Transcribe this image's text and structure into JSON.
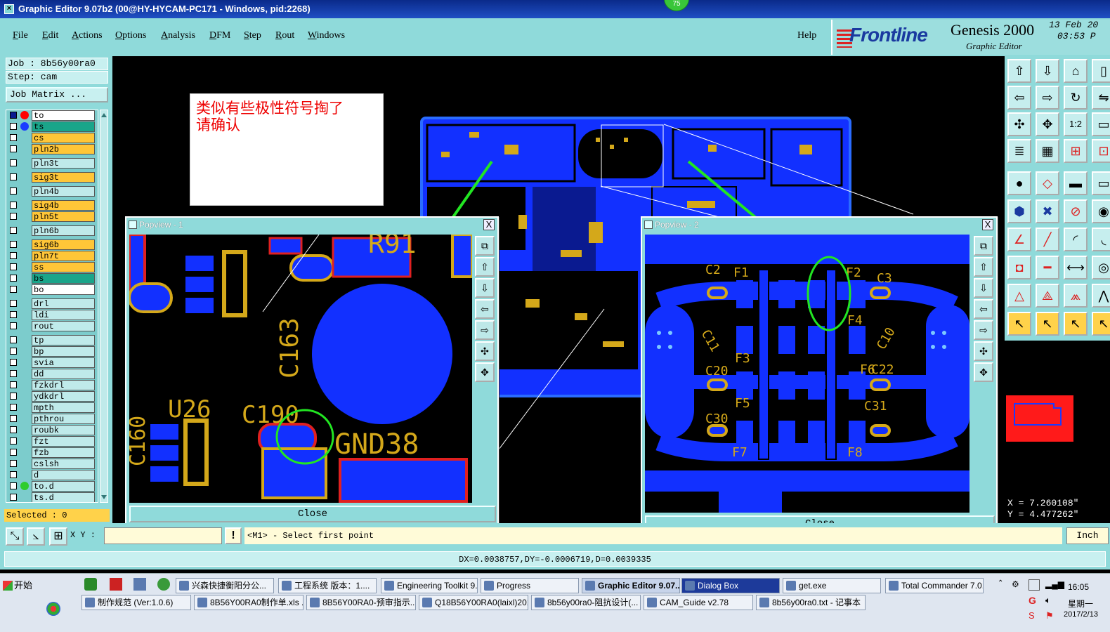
{
  "window": {
    "title": "Graphic Editor 9.07b2 (00@HY-HYCAM-PC171 - Windows, pid:2268)",
    "badge": "75"
  },
  "menu": {
    "items": [
      "File",
      "Edit",
      "Actions",
      "Options",
      "Analysis",
      "DFM",
      "Step",
      "Rout",
      "Windows"
    ],
    "help": "Help"
  },
  "brand": {
    "logo": "Frontline",
    "product": "Genesis 2000",
    "subtitle": "Graphic Editor",
    "date_line1": "13 Feb 20",
    "date_line2": "03:53 P"
  },
  "job": {
    "job_label": "Job : 8b56y00ra0",
    "step_label": "Step: cam",
    "matrix_button": "Job Matrix ..."
  },
  "layers": [
    {
      "name": "to",
      "color": "#ffffff",
      "dot": "#ff0000",
      "sel": true
    },
    {
      "name": "ts",
      "color": "#1aa58a",
      "dot": "#1a3cff"
    },
    {
      "name": "cs",
      "color": "#ffc638"
    },
    {
      "name": "pln2b",
      "color": "#ffc638"
    },
    {
      "name": "pln3t",
      "color": "#bfeaea"
    },
    {
      "name": "sig3t",
      "color": "#ffc638"
    },
    {
      "name": "pln4b",
      "color": "#bfeaea"
    },
    {
      "name": "sig4b",
      "color": "#ffc638"
    },
    {
      "name": "pln5t",
      "color": "#ffc638"
    },
    {
      "name": "pln6b",
      "color": "#bfeaea"
    },
    {
      "name": "sig6b",
      "color": "#ffc638"
    },
    {
      "name": "pln7t",
      "color": "#ffc638"
    },
    {
      "name": "ss",
      "color": "#ffc638"
    },
    {
      "name": "bs",
      "color": "#1aa58a"
    },
    {
      "name": "bo",
      "color": "#ffffff"
    },
    {
      "name": "drl",
      "color": "#bfeaea"
    },
    {
      "name": "ldi",
      "color": "#bfeaea"
    },
    {
      "name": "rout",
      "color": "#bfeaea"
    },
    {
      "name": "tp",
      "color": "#bfeaea"
    },
    {
      "name": "bp",
      "color": "#bfeaea"
    },
    {
      "name": "svia",
      "color": "#bfeaea"
    },
    {
      "name": "dd",
      "color": "#bfeaea"
    },
    {
      "name": "fzkdrl",
      "color": "#bfeaea"
    },
    {
      "name": "ydkdrl",
      "color": "#bfeaea"
    },
    {
      "name": "mpth",
      "color": "#bfeaea"
    },
    {
      "name": "pthrou",
      "color": "#bfeaea"
    },
    {
      "name": "roubk",
      "color": "#bfeaea"
    },
    {
      "name": "fzt",
      "color": "#bfeaea"
    },
    {
      "name": "fzb",
      "color": "#bfeaea"
    },
    {
      "name": "cslsh",
      "color": "#bfeaea"
    },
    {
      "name": "d",
      "color": "#bfeaea"
    },
    {
      "name": "to.d",
      "color": "#bfeaea",
      "dot": "#2ecc2e"
    },
    {
      "name": "ts.d",
      "color": "#bfeaea"
    }
  ],
  "selected": "Selected : 0",
  "annotation": {
    "line1": "类似有些极性符号掏了",
    "line2": "请确认"
  },
  "popview1": {
    "title": "Popview - 1",
    "close": "Close",
    "close_x": "X",
    "labels": {
      "r91": "R91",
      "c163": "C163",
      "u26": "U26",
      "c190": "C190",
      "gnd38": "GND38",
      "c160": "C160"
    }
  },
  "popview2": {
    "title": "Popview - 2",
    "close": "Close",
    "close_x": "X",
    "labels": {
      "c2": "C2",
      "f1": "F1",
      "f2": "F2",
      "c3": "C3",
      "f4": "F4",
      "c11": "C11",
      "c10": "C10",
      "f3": "F3",
      "c20": "C20",
      "f6": "F6",
      "c22": "C22",
      "f5": "F5",
      "c31": "C31",
      "c30": "C30",
      "f7": "F7",
      "f8": "F8"
    }
  },
  "coords": {
    "x": "X = 7.260108\"",
    "y": "Y = 4.477262\""
  },
  "cmd": {
    "xy_label": "X Y :",
    "xy_value": "",
    "message": "<M1> - Select first point",
    "units": "Inch"
  },
  "status": "DX=0.0038757,DY=-0.0006719,D=0.0039335",
  "taskbar": {
    "start": "开始",
    "row1": [
      "兴森快捷衡阳分公...",
      "工程系统  版本：1....",
      "Engineering Toolkit 9....",
      "Progress",
      "Graphic Editor 9.07...",
      "Dialog Box",
      "get.exe",
      "Total Commander 7.0..."
    ],
    "row2": [
      "制作规范 (Ver:1.0.6)",
      "8B56Y00RA0制作单.xls ...",
      "8B56Y00RA0-预审指示....",
      "Q18B56Y00RA0(laixl)201...",
      "8b56y00ra0-阻抗设计(...",
      "CAM_Guide v2.78",
      "8b56y00ra0.txt - 记事本"
    ],
    "time": "16:05",
    "weekday": "星期一",
    "date": "2017/2/13"
  },
  "colors": {
    "copper": "#1230ff",
    "pad_yellow": "#d4a81a",
    "pad_red": "#e02020",
    "arrow": "#22e622",
    "panel": "#8fdada"
  }
}
